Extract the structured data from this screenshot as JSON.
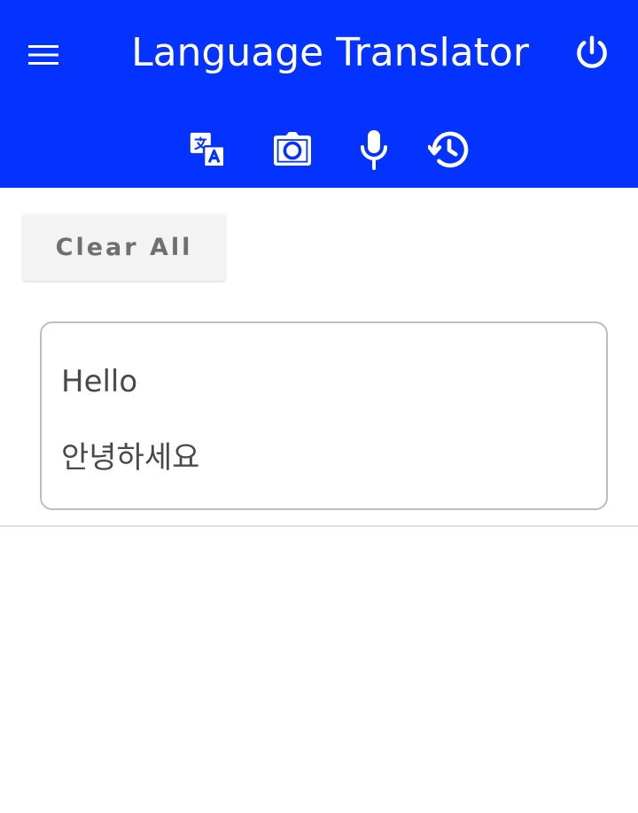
{
  "app_bar": {
    "title": "Language Translator",
    "background_color": "#0433ff",
    "menu_icon": "hamburger-menu-icon",
    "power_icon": "power-icon",
    "tabs": [
      {
        "name": "translate",
        "icon": "translate-icon"
      },
      {
        "name": "camera",
        "icon": "camera-icon"
      },
      {
        "name": "voice",
        "icon": "microphone-icon"
      },
      {
        "name": "history",
        "icon": "history-icon"
      }
    ]
  },
  "actions": {
    "clear_all_label": "Clear All"
  },
  "translations": [
    {
      "source": "Hello",
      "target": "안녕하세요"
    }
  ]
}
